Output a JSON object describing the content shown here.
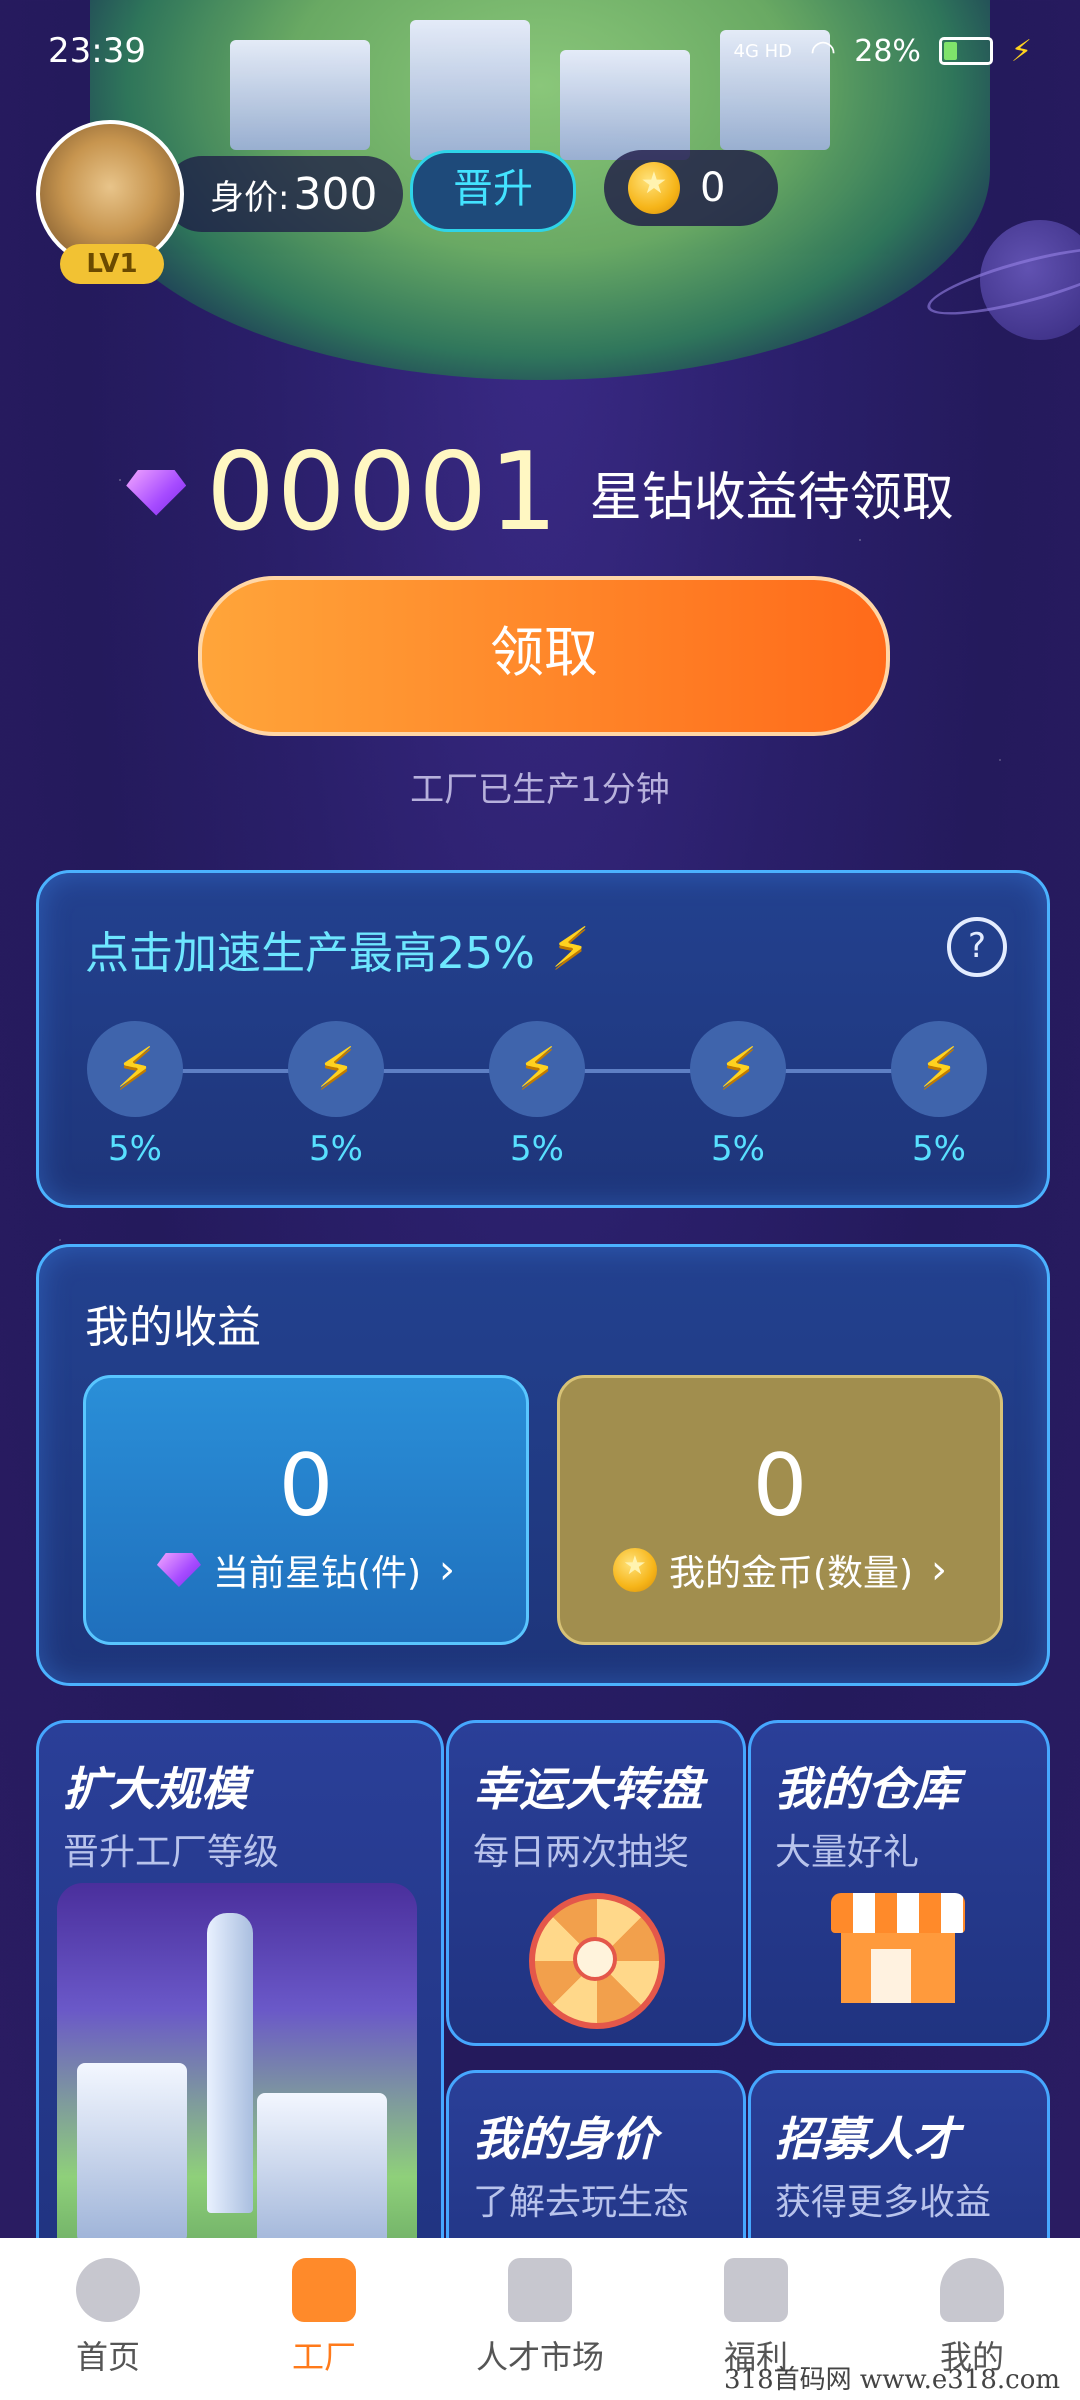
{
  "status_bar": {
    "time": "23:39",
    "network": "4G HD",
    "battery": "28%"
  },
  "profile": {
    "level": "LV1",
    "worth_label": "身价:",
    "worth_value": "300",
    "promote_label": "晋升",
    "coins": "0"
  },
  "diamonds": {
    "count": "00001",
    "pending_text": "星钻收益待领取"
  },
  "claim": {
    "button_label": "领取",
    "produced_text": "工厂已生产1分钟"
  },
  "boost": {
    "title": "点击加速生产最高25%",
    "help_icon": "?",
    "items": [
      {
        "pct": "5%"
      },
      {
        "pct": "5%"
      },
      {
        "pct": "5%"
      },
      {
        "pct": "5%"
      },
      {
        "pct": "5%"
      }
    ]
  },
  "income": {
    "title": "我的收益",
    "diamonds_value": "0",
    "diamonds_label": "当前星钻(件)",
    "coins_value": "0",
    "coins_label": "我的金币(数量)"
  },
  "tiles": [
    {
      "title": "扩大规模",
      "sub": "晋升工厂等级"
    },
    {
      "title": "幸运大转盘",
      "sub": "每日两次抽奖"
    },
    {
      "title": "我的仓库",
      "sub": "大量好礼"
    },
    {
      "title": "我的身价",
      "sub": "了解去玩生态"
    },
    {
      "title": "招募人才",
      "sub": "获得更多收益"
    }
  ],
  "nav": [
    {
      "label": "首页",
      "icon": "planet-icon"
    },
    {
      "label": "工厂",
      "icon": "home-icon"
    },
    {
      "label": "人才市场",
      "icon": "market-icon"
    },
    {
      "label": "福利",
      "icon": "gift-icon"
    },
    {
      "label": "我的",
      "icon": "user-icon"
    }
  ],
  "watermark": "318首码网  www.e318.com",
  "colors": {
    "accent_orange": "#ff7a1a",
    "cyan": "#43e3ff",
    "gold": "#f6b519",
    "card_border": "#4bb2ff"
  }
}
